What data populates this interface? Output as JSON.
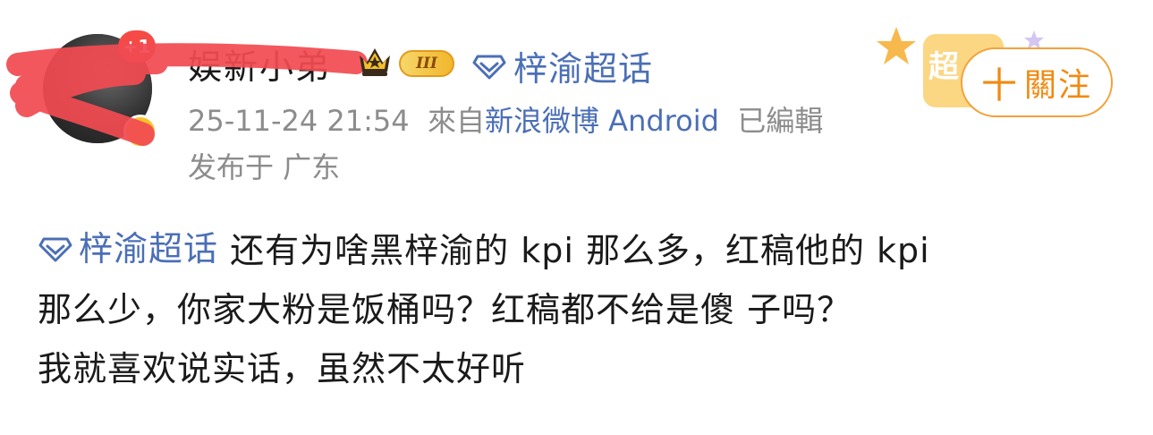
{
  "profile": {
    "badge_count": "+1",
    "username": "娱新小弟",
    "level_label": "III"
  },
  "header": {
    "supertopic": "梓渝超话",
    "timestamp": "25-11-24 21:54",
    "from_prefix": "來自",
    "source": "新浪微博 Android",
    "edited": "已編輯",
    "location": "发布于 广东",
    "follow_label": "關注",
    "follow_plus": "十",
    "deco_label": "超"
  },
  "post": {
    "tag": "梓渝超话",
    "line1_rest": "还有为啥黑梓渝的 kpi 那么多，红稿他的 kpi",
    "line2": "那么少，你家大粉是饭桶吗？红稿都不给是傻 子吗？",
    "line3": "我就喜欢说实话，虽然不太好听"
  },
  "colors": {
    "link": "#4b6fb6",
    "follow": "#f08a12",
    "meta": "#8c8c8c",
    "badge": "#f54a45",
    "scribble": "#f24b52"
  }
}
